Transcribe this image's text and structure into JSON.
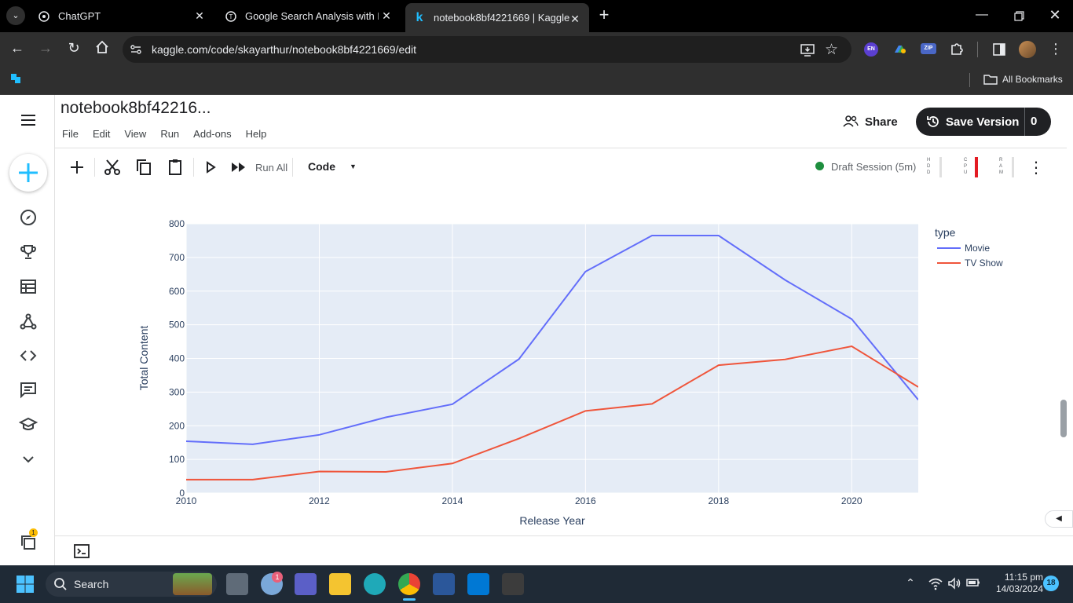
{
  "browser": {
    "tabs": [
      {
        "title": "ChatGPT",
        "active": false
      },
      {
        "title": "Google Search Analysis with Py",
        "active": false
      },
      {
        "title": "notebook8bf4221669 | Kaggle",
        "active": true
      }
    ],
    "url": "kaggle.com/code/skayarthur/notebook8bf4221669/edit",
    "bookmarks_label": "All Bookmarks",
    "extension_en": "EN",
    "extension_zip": "ZIP"
  },
  "notebook": {
    "title": "notebook8bf42216...",
    "menu": [
      "File",
      "Edit",
      "View",
      "Run",
      "Add-ons",
      "Help"
    ],
    "share_label": "Share",
    "save_label": "Save Version",
    "save_count": "0",
    "toolbar": {
      "run_all_label": "Run All",
      "cell_type": "Code",
      "session_label": "Draft Session (5m)",
      "hdd": "HDD",
      "cpu": "CPU",
      "ram": "RAM"
    }
  },
  "chart_data": {
    "type": "line",
    "xlabel": "Release Year",
    "ylabel": "Total Content",
    "legend_title": "type",
    "legend_position": "right",
    "xlim": [
      2010,
      2021
    ],
    "ylim": [
      0,
      800
    ],
    "xticks": [
      2010,
      2012,
      2014,
      2016,
      2018,
      2020
    ],
    "yticks": [
      0,
      100,
      200,
      300,
      400,
      500,
      600,
      700,
      800
    ],
    "grid": true,
    "x": [
      2010,
      2011,
      2012,
      2013,
      2014,
      2015,
      2016,
      2017,
      2018,
      2019,
      2020,
      2021
    ],
    "series": [
      {
        "name": "Movie",
        "color": "#636efa",
        "values": [
          154,
          145,
          173,
          225,
          264,
          398,
          658,
          765,
          765,
          633,
          517,
          277
        ]
      },
      {
        "name": "TV Show",
        "color": "#ef553b",
        "values": [
          40,
          40,
          64,
          63,
          88,
          162,
          244,
          265,
          380,
          397,
          436,
          315
        ]
      }
    ]
  },
  "taskbar": {
    "search_label": "Search",
    "time": "11:15 pm",
    "date": "14/03/2024",
    "notification_count": "18",
    "weather_badge": "1"
  },
  "rail": {
    "badge": "1"
  }
}
